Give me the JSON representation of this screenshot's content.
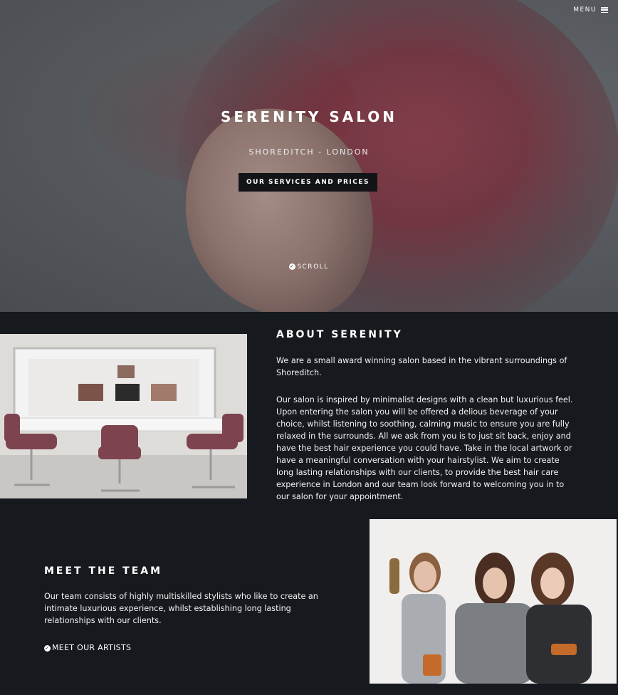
{
  "nav": {
    "menu_label": "MENU"
  },
  "hero": {
    "title": "SERENITY SALON",
    "subtitle": "SHOREDITCH - LONDON",
    "cta_label": "OUR SERVICES AND PRICES",
    "scroll_label": "SCROLL"
  },
  "about": {
    "title": "ABOUT SERENITY",
    "paragraph1": "We are a small award winning salon based in the vibrant surroundings of Shoreditch.",
    "paragraph2": "Our salon is inspired by minimalist designs with a clean but luxurious feel. Upon entering the salon you will be offered a delious beverage of your choice, whilst listening to soothing, calming music to ensure you are fully relaxed in the surrounds. All we ask from you is to just sit back, enjoy and have the best hair experience you could have. Take in the local artwork or have a meaningful conversation with your hairstylist. We aim to create long lasting relationships with our clients, to provide the best hair care experience in London and our team look forward to welcoming you in to our salon for your appointment."
  },
  "team": {
    "title": "MEET THE TEAM",
    "paragraph": "Our team consists of highly multiskilled stylists who like to create an intimate luxurious experience, whilst establishing long lasting relationships with our clients.",
    "link_label": "MEET OUR ARTISTS"
  },
  "icons": {
    "menu": "hamburger-icon",
    "scroll": "chevron-down-circle-icon",
    "artists": "chevron-down-circle-icon"
  },
  "colors": {
    "background": "#16191d",
    "hair_accent": "#a84657",
    "button_bg": "#121417",
    "text": "#ffffff"
  }
}
